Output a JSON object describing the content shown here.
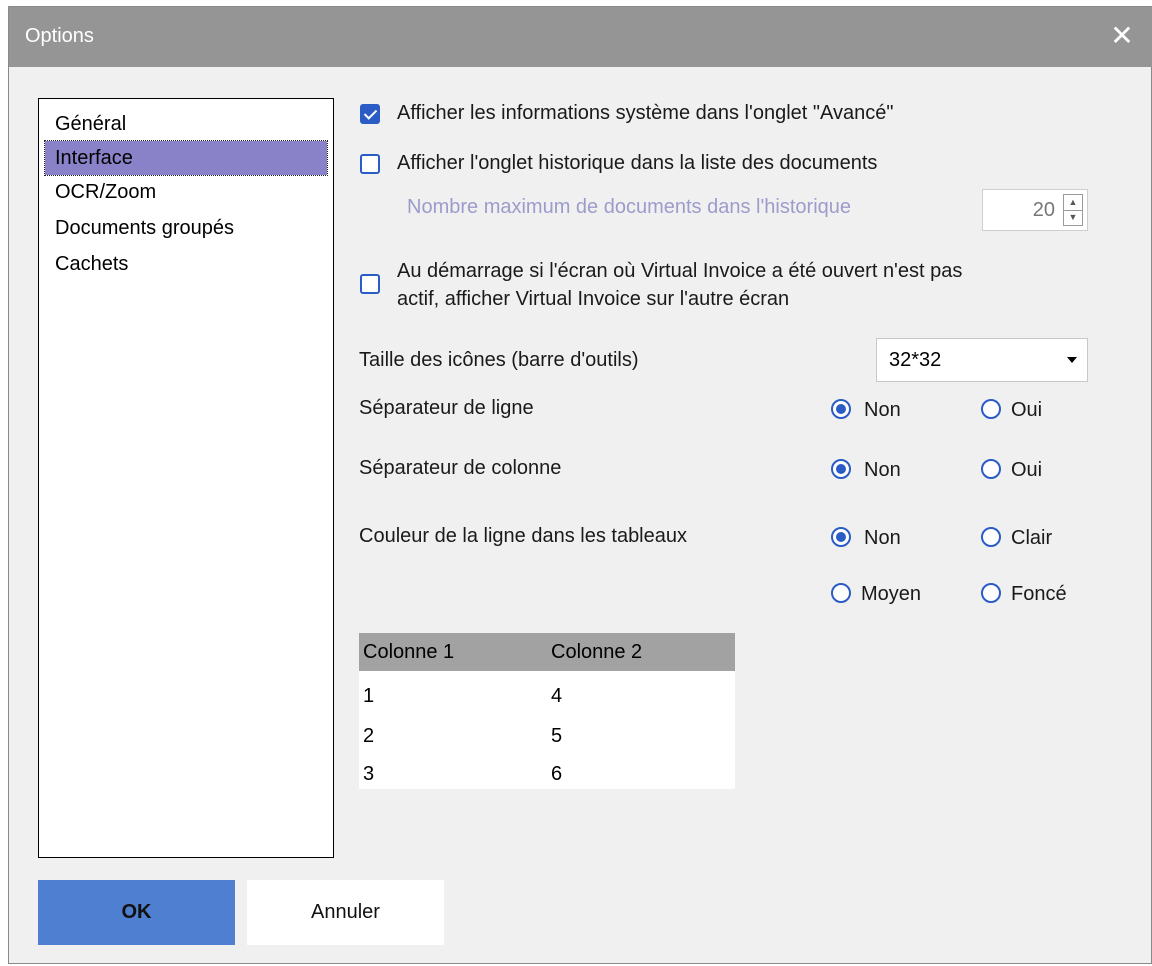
{
  "window": {
    "title": "Options"
  },
  "nav": {
    "items": [
      {
        "label": "Général"
      },
      {
        "label": "Interface",
        "selected": true
      },
      {
        "label": "OCR/Zoom"
      },
      {
        "label": "Documents groupés"
      },
      {
        "label": "Cachets"
      }
    ]
  },
  "settings": {
    "show_system_info": {
      "label": "Afficher les informations système dans l'onglet \"Avancé\"",
      "checked": true
    },
    "show_history_tab": {
      "label": "Afficher l'onglet historique dans la liste des documents",
      "checked": false
    },
    "max_history": {
      "label": "Nombre maximum de documents dans l'historique",
      "value": "20"
    },
    "other_screen": {
      "label_line1": "Au démarrage si l'écran où Virtual Invoice a été ouvert n'est pas",
      "label_line2": "actif, afficher Virtual Invoice sur l'autre écran",
      "checked": false
    },
    "icon_size": {
      "label": "Taille des icônes (barre d'outils)",
      "value": "32*32"
    },
    "row_separator": {
      "label": "Séparateur de ligne",
      "options": [
        "Non",
        "Oui"
      ],
      "selected": "Non"
    },
    "col_separator": {
      "label": "Séparateur de colonne",
      "options": [
        "Non",
        "Oui"
      ],
      "selected": "Non"
    },
    "row_color": {
      "label": "Couleur de la ligne dans les tableaux",
      "options": [
        "Non",
        "Clair",
        "Moyen",
        "Foncé"
      ],
      "selected": "Non"
    }
  },
  "preview": {
    "headers": [
      "Colonne 1",
      "Colonne 2"
    ],
    "rows": [
      [
        "1",
        "4"
      ],
      [
        "2",
        "5"
      ],
      [
        "3",
        "6"
      ]
    ]
  },
  "buttons": {
    "ok": "OK",
    "cancel": "Annuler"
  },
  "colors": {
    "accent": "#2b5cc5",
    "selection": "#8a82c8",
    "ok_button": "#4e7fd0",
    "titlebar": "#959595"
  },
  "icons": {
    "close": "close-icon",
    "spin_up": "chevron-up-icon",
    "spin_down": "chevron-down-icon",
    "dropdown": "caret-down-icon"
  }
}
